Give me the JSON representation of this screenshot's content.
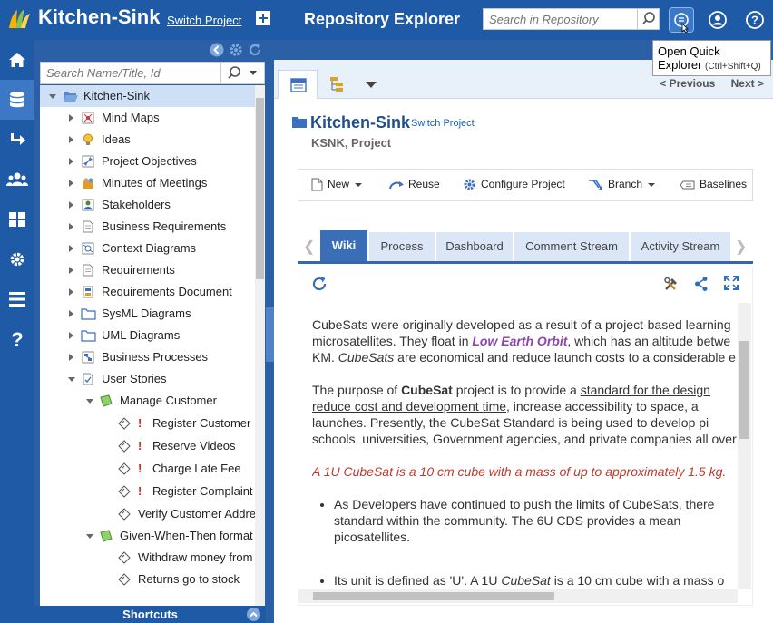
{
  "topbar": {
    "app_title": "Kitchen-Sink",
    "switch_project": "Switch Project",
    "page_title": "Repository Explorer",
    "search_placeholder": "Search in Repository"
  },
  "tooltip": {
    "line1": "Open Quick",
    "line2": "Explorer",
    "shortcut": "(Ctrl+Shift+Q)"
  },
  "tree_panel": {
    "search_placeholder": "Search Name/Title, Id",
    "shortcuts_label": "Shortcuts",
    "items": [
      {
        "label": "Kitchen-Sink",
        "icon": "folder-open-icon"
      },
      {
        "label": "Mind Maps",
        "icon": "mind-map-icon"
      },
      {
        "label": "Ideas",
        "icon": "lightbulb-icon"
      },
      {
        "label": "Project Objectives",
        "icon": "pin-icon"
      },
      {
        "label": "Minutes of Meetings",
        "icon": "meeting-icon"
      },
      {
        "label": "Stakeholders",
        "icon": "stakeholder-icon"
      },
      {
        "label": "Business Requirements",
        "icon": "document-icon"
      },
      {
        "label": "Context Diagrams",
        "icon": "diagram-icon"
      },
      {
        "label": "Requirements",
        "icon": "document-icon"
      },
      {
        "label": "Requirements Document",
        "icon": "report-icon"
      },
      {
        "label": "SysML Diagrams",
        "icon": "folder-icon"
      },
      {
        "label": "UML Diagrams",
        "icon": "folder-icon"
      },
      {
        "label": "Business Processes",
        "icon": "process-icon"
      },
      {
        "label": "User Stories",
        "icon": "user-story-icon"
      },
      {
        "label": "Manage Customer",
        "icon": "epic-icon"
      },
      {
        "label": "Register Customer",
        "icon": "story-icon"
      },
      {
        "label": "Reserve Videos",
        "icon": "story-icon"
      },
      {
        "label": "Charge Late Fee",
        "icon": "story-icon"
      },
      {
        "label": "Register Complaint",
        "icon": "story-icon"
      },
      {
        "label": "Verify Customer Address",
        "icon": "story-icon"
      },
      {
        "label": "Given-When-Then format",
        "icon": "epic-icon"
      },
      {
        "label": "Withdraw money from ATM",
        "icon": "story-icon"
      },
      {
        "label": "Returns go to stock",
        "icon": "story-icon"
      }
    ]
  },
  "main": {
    "pager_prev": "< Previous",
    "pager_next": "Next >",
    "project_title": "Kitchen-Sink",
    "project_switch": "Switch Project",
    "project_sub": "KSNK, Project",
    "toolbar": {
      "new": "New",
      "reuse": "Reuse",
      "configure": "Configure Project",
      "branch": "Branch",
      "baselines": "Baselines"
    },
    "tabs": [
      "Wiki",
      "Process",
      "Dashboard",
      "Comment Stream",
      "Activity Stream"
    ],
    "wiki": {
      "p1_l1": "CubeSats were originally developed as a result of a project-based learning",
      "p1_l2a": "microsatellites. They float in ",
      "p1_l2b": "Low Earth Orbit",
      "p1_l2c": ", which has an altitude betwe",
      "p1_l3a": "KM. ",
      "p1_l3b": "CubeSats",
      "p1_l3c": " are economical and reduce launch costs to a considerable e",
      "p2_l1a": "The purpose of ",
      "p2_l1b": "CubeSat",
      "p2_l1c": " project is to provide a ",
      "p2_l1d": "standard for the design",
      "p2_l2a": "reduce cost and development time",
      "p2_l2b": ", increase accessibility to space, a",
      "p2_l3": "launches. Presently, the CubeSat Standard is being used to develop pi",
      "p2_l4": "schools, universities, Government agencies, and private companies all over",
      "red": "A 1U CubeSat is a 10 cm cube with a mass of up to approximately 1.5 kg.",
      "li1_l1": "As Developers have continued to push the limits of CubeSats, there",
      "li1_l2": "standard within the community. The 6U CDS provides a mean",
      "li1_l3": "picosatellites.",
      "li2_a": "Its unit is defined as 'U'. A 1U ",
      "li2_b": "CubeSat",
      "li2_c": " is a 10 cm cube with a mass o"
    }
  }
}
